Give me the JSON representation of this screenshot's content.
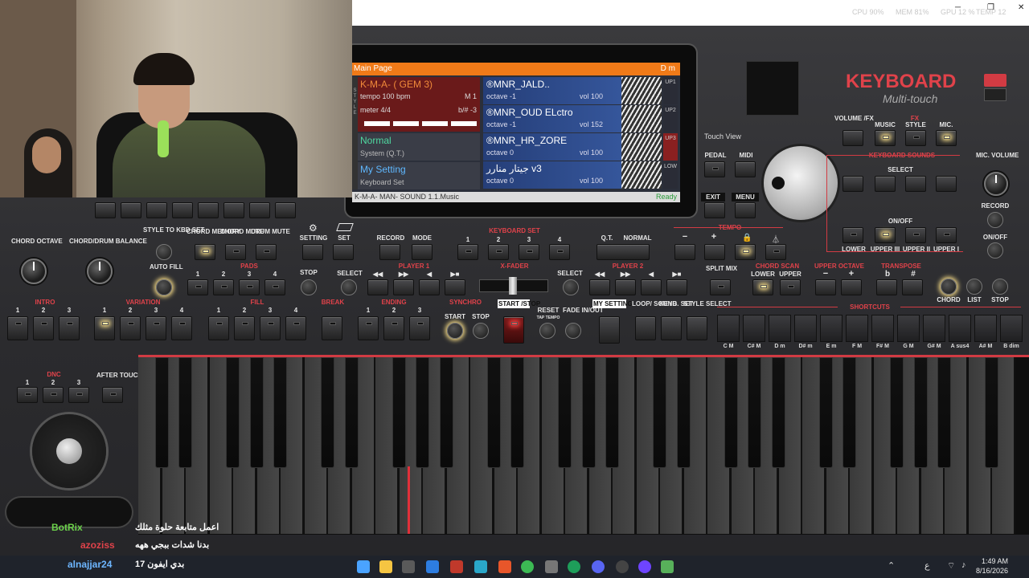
{
  "titlebar": {
    "stats": [
      "CPU 90%",
      "MEM 81%",
      "GPU 12 %",
      "TEMP 12"
    ],
    "window_buttons": [
      "─",
      "❐",
      "✕"
    ]
  },
  "brand": {
    "title": "KEYBOARD",
    "subtitle": "Multi-touch",
    "touch_view": "Touch View"
  },
  "screen": {
    "header_left": "Main Page",
    "header_right": "D m",
    "style_name": "K-M-A- ( GEM 3)",
    "tempo": "tempo 100 bpm",
    "measure": "M 1",
    "meter": "meter 4/4",
    "transpose": "b/# -3",
    "normal_title": "Normal",
    "normal_sub": "System (Q.T.)",
    "my_setting_title": "My Setting",
    "my_setting_sub": "Keyboard Set",
    "tracks": [
      {
        "name": "®MNR_JALD..",
        "octave": "octave -1",
        "vol": "vol 100",
        "side": "UP1"
      },
      {
        "name": "®MNR_OUD ELctro",
        "octave": "octave -1",
        "vol": "vol 152",
        "side": "UP2"
      },
      {
        "name": "®MNR_HR_ZORE",
        "octave": "octave 0",
        "vol": "vol 100",
        "side": "UP3"
      },
      {
        "name": "جيتار منارر v3",
        "octave": "octave 0",
        "vol": "vol 100",
        "side": "LOW"
      }
    ],
    "left_side_labels": [
      "STYLE",
      "SPL",
      "KEYB"
    ],
    "footer_left": "K-M-A- MAN- SOUND 1.1.Music",
    "footer_right": "Ready"
  },
  "left_panel": {
    "chord_octave": "CHORD OCTAVE",
    "chord_drum_balance": "CHORD/DRUM BALANCE",
    "style_to_kbd": "STYLE TO KBD SET",
    "chord_memory": "CHORD MEMORY",
    "chord_mute": "CHORD MUTE",
    "drum_mute": "DRUM MUTE",
    "setting": "SETTING",
    "set": "SET",
    "auto_fill": "AUTO FILL",
    "pads": "PADS",
    "pad_numbers": [
      "1",
      "2",
      "3",
      "4"
    ],
    "stop": "STOP",
    "intro": "INTRO",
    "intro_numbers": [
      "1",
      "2",
      "3"
    ],
    "variation": "VARIATION",
    "variation_numbers": [
      "1",
      "2",
      "3",
      "4"
    ],
    "fill": "FILL",
    "fill_numbers": [
      "1",
      "2",
      "3",
      "4"
    ],
    "break": "BREAK",
    "ending": "ENDING",
    "ending_numbers": [
      "1",
      "2",
      "3"
    ],
    "dnc": "DNC",
    "dnc_numbers": [
      "1",
      "2",
      "3"
    ],
    "after_touch": "AFTER TOUCH"
  },
  "center_panel": {
    "record": "RECORD",
    "mode": "MODE",
    "keyboard_set": "KEYBOARD SET",
    "kbd_numbers": [
      "1",
      "2",
      "3",
      "4"
    ],
    "qt": "Q.T.",
    "normal": "NORMAL",
    "select1": "SELECT",
    "player1": "PLAYER 1",
    "xfader": "X-FADER",
    "select2": "SELECT",
    "player2": "PLAYER 2",
    "transport": [
      "◀◀",
      "▶▶",
      "◀",
      "▶■"
    ],
    "synchro": "SYNCHRO",
    "start": "START",
    "stop": "STOP",
    "start_stop": "START /STOP",
    "reset": "RESET",
    "tap_tempo": "TAP TEMPO",
    "fade": "FADE IN/OUT",
    "my_setting": "MY SETTING",
    "loop_sound": "LOOP/ SOUND",
    "keyb_set": "KEYB. SET",
    "style_select": "STYLE SELECT"
  },
  "right_panel": {
    "tempo": "TEMPO",
    "tempo_minus": "−",
    "tempo_plus": "+",
    "split_mix": "SPLIT MIX",
    "chord_scan": "CHORD SCAN",
    "lower": "LOWER",
    "upper": "UPPER",
    "upper_octave": "UPPER OCTAVE",
    "transpose": "TRANSPOSE",
    "flat": "b",
    "sharp": "#",
    "pedal": "PEDAL",
    "midi": "MIDI",
    "exit": "EXIT",
    "menu": "MENU",
    "volume_fx": "VOLUME /FX",
    "fx": "FX",
    "music": "MUSIC",
    "style": "STYLE",
    "mic": "MIC.",
    "keyboard_sounds": "KEYBOARD SOUNDS",
    "select": "SELECT",
    "on_off": "ON/OFF",
    "parts": [
      "LOWER",
      "UPPER III",
      "UPPER II",
      "UPPER I"
    ],
    "mic_volume": "MIC. VOLUME",
    "record": "RECORD",
    "on_off2": "ON/OFF",
    "chord": "CHORD",
    "list": "LIST",
    "stop": "STOP",
    "shortcuts": "SHORTCUTS",
    "shortcut_labels": [
      "C M",
      "C# M",
      "D m",
      "D# m",
      "E m",
      "F M",
      "F# M",
      "G M",
      "G# M",
      "A sus4",
      "A# M",
      "B dim"
    ]
  },
  "chat": {
    "line1_user": "BotRix",
    "line1_msg": "اعمل متابعة حلوة مثلك",
    "line2_user": "azoziss",
    "line2_msg": "بدنا شدات ببجي ههه",
    "line3_user": "alnajjar24",
    "line3_msg": "بدي ايفون 17"
  },
  "taskbar": {
    "time": "1:49 AM",
    "date": "8/16/2026",
    "lang": "ع"
  },
  "colors": {
    "accent": "#d23b43",
    "screen_header": "#f07a18",
    "track_blue": "#2f4f98"
  }
}
